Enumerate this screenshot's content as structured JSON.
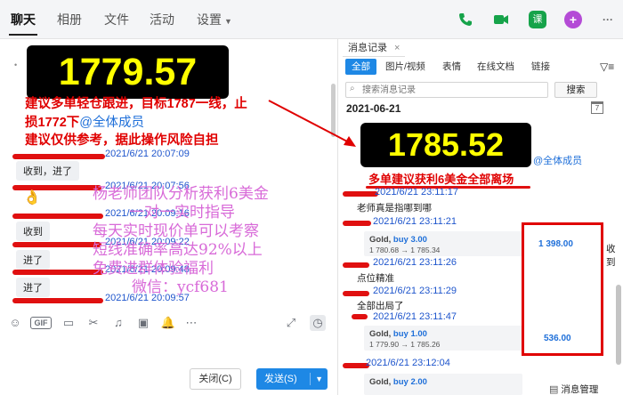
{
  "top_tabs": [
    {
      "label": "聊天",
      "active": true
    },
    {
      "label": "相册",
      "active": false
    },
    {
      "label": "文件",
      "active": false
    },
    {
      "label": "活动",
      "active": false
    },
    {
      "label": "设置",
      "active": false
    }
  ],
  "top_icons": {
    "phone": "phone-icon",
    "video": "video-call-icon",
    "class": "课",
    "add": "+",
    "more": "···"
  },
  "chat": {
    "price_main": "1779.57",
    "advice_line1": "建议多单轻仓跟进，目标1787一线，止",
    "advice_line2": "损1772下",
    "advice_mention": "@全体成员",
    "disclaimer": "建议仅供参考，据此操作风险自担",
    "messages": [
      {
        "timestamp": "2021/6/21 20:07:09",
        "text": "收到，进了"
      },
      {
        "timestamp": "2021/6/21 20:07:56",
        "text": ""
      },
      {
        "timestamp": "2021/6/21 20:09:16",
        "text": "收到"
      },
      {
        "timestamp": "2021/6/21 20:09:22",
        "text": "进了"
      },
      {
        "timestamp": "2021/6/21 20:09:48",
        "text": "进了"
      },
      {
        "timestamp": "2021/6/21 20:09:57",
        "text": ""
      }
    ],
    "emoji_reply": "👌"
  },
  "buttons": {
    "close": "关闭(C)",
    "send": "发送(S)"
  },
  "watermark": [
    "杨老师团队分析获利6美金",
    "一对一实时指导",
    "每天实时现价单可以考察",
    "短线准确率高达92%以上",
    "免费进群体验福利",
    "微信：ycf681"
  ],
  "history": {
    "title": "消息记录",
    "close_glyph": "×",
    "tabs": [
      "全部",
      "图片/视频",
      "表情",
      "在线文档",
      "链接"
    ],
    "search_placeholder": "搜索消息记录",
    "search_button": "搜索",
    "date": "2021-06-21",
    "calendar_day": "7",
    "price_main": "1785.52",
    "mention": "@全体成员",
    "result_text": "多单建议获利6美金全部离场",
    "entries": [
      {
        "timestamp": "2021/6/21 23:11:17",
        "text": "老师真是指哪到哪"
      },
      {
        "timestamp": "2021/6/21 23:11:21",
        "text": ""
      },
      {
        "timestamp": "2021/6/21 23:11:26",
        "text": "点位精准"
      },
      {
        "timestamp": "2021/6/21 23:11:29",
        "text": "全部出局了"
      },
      {
        "timestamp": "2021/6/21 23:11:47",
        "text": ""
      },
      {
        "timestamp": "2021/6/21 23:12:04",
        "text": ""
      }
    ],
    "gold_cards": [
      {
        "product": "Gold,",
        "action": "buy 3.00",
        "path": "1 780.68 → 1 785.34",
        "profit": "1 398.00",
        "trail": "收到"
      },
      {
        "product": "Gold,",
        "action": "buy 1.00",
        "path": "1 779.90 → 1 785.26",
        "profit": "536.00",
        "trail": ""
      },
      {
        "product": "Gold,",
        "action": "buy 2.00",
        "path": "",
        "profit": "",
        "trail": ""
      }
    ],
    "manage_label": "消息管理"
  },
  "colors": {
    "accent": "#1e88e5",
    "alert_red": "#e00000",
    "price_yellow": "#ffff00",
    "watermark_pink": "#d86ad8",
    "timestamp_blue": "#1e55cc"
  }
}
